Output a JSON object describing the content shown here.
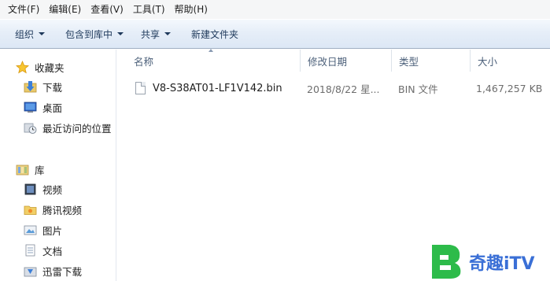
{
  "menubar": {
    "items": [
      "文件(F)",
      "编辑(E)",
      "查看(V)",
      "工具(T)",
      "帮助(H)"
    ]
  },
  "toolbar": {
    "organize": "组织",
    "include_in_library": "包含到库中",
    "share": "共享",
    "new_folder": "新建文件夹"
  },
  "nav": {
    "favorites": "收藏夹",
    "downloads": "下载",
    "desktop": "桌面",
    "recent": "最近访问的位置",
    "libraries": "库",
    "videos": "视频",
    "tencent_video": "腾讯视频",
    "pictures": "图片",
    "documents": "文档",
    "xunlei_download": "迅雷下载"
  },
  "columns": {
    "name": "名称",
    "date": "修改日期",
    "type": "类型",
    "size": "大小"
  },
  "files": [
    {
      "name": "V8-S38AT01-LF1V142.bin",
      "date": "2018/8/22 星...",
      "type": "BIN 文件",
      "size": "1,467,257 KB"
    }
  ],
  "watermark": {
    "text": "奇趣iTV",
    "colors": {
      "green": "#2dbb4a",
      "blue": "#3a6fd6"
    }
  }
}
